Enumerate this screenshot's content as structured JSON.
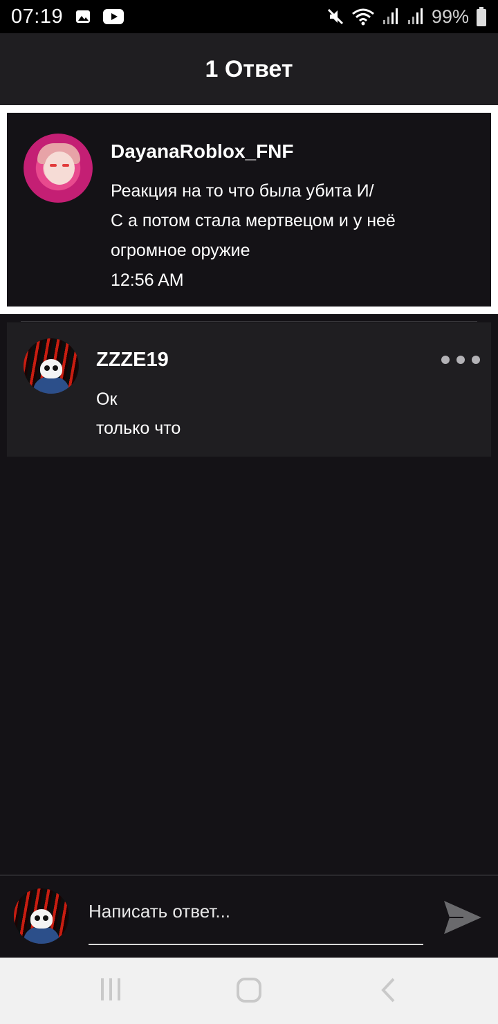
{
  "status_bar": {
    "time": "07:19",
    "battery_percent": "99%",
    "icons": [
      "image-icon",
      "youtube-icon",
      "mute-icon",
      "wifi-icon",
      "signal-icon",
      "signal-icon",
      "battery-icon"
    ]
  },
  "header": {
    "title": "1 Ответ"
  },
  "original_comment": {
    "author": "DayanaRoblox_FNF",
    "lines": [
      "Реакция на то что была убита И/",
      "С а потом стала мертвецом и у неё",
      "огромное оружие"
    ],
    "time": "12:56 AM"
  },
  "reply": {
    "author": "ZZZE19",
    "text": "Ок",
    "time": "только что",
    "more_icon": "more-dots-icon"
  },
  "composer": {
    "placeholder": "Написать ответ...",
    "send_icon": "send-icon"
  },
  "nav_bar": {
    "icons": [
      "recent-apps-icon",
      "home-icon",
      "back-icon"
    ]
  },
  "colors": {
    "background": "#141216",
    "header": "#1f1e21",
    "card": "#1f1e21",
    "nav": "#f1f1f1"
  }
}
